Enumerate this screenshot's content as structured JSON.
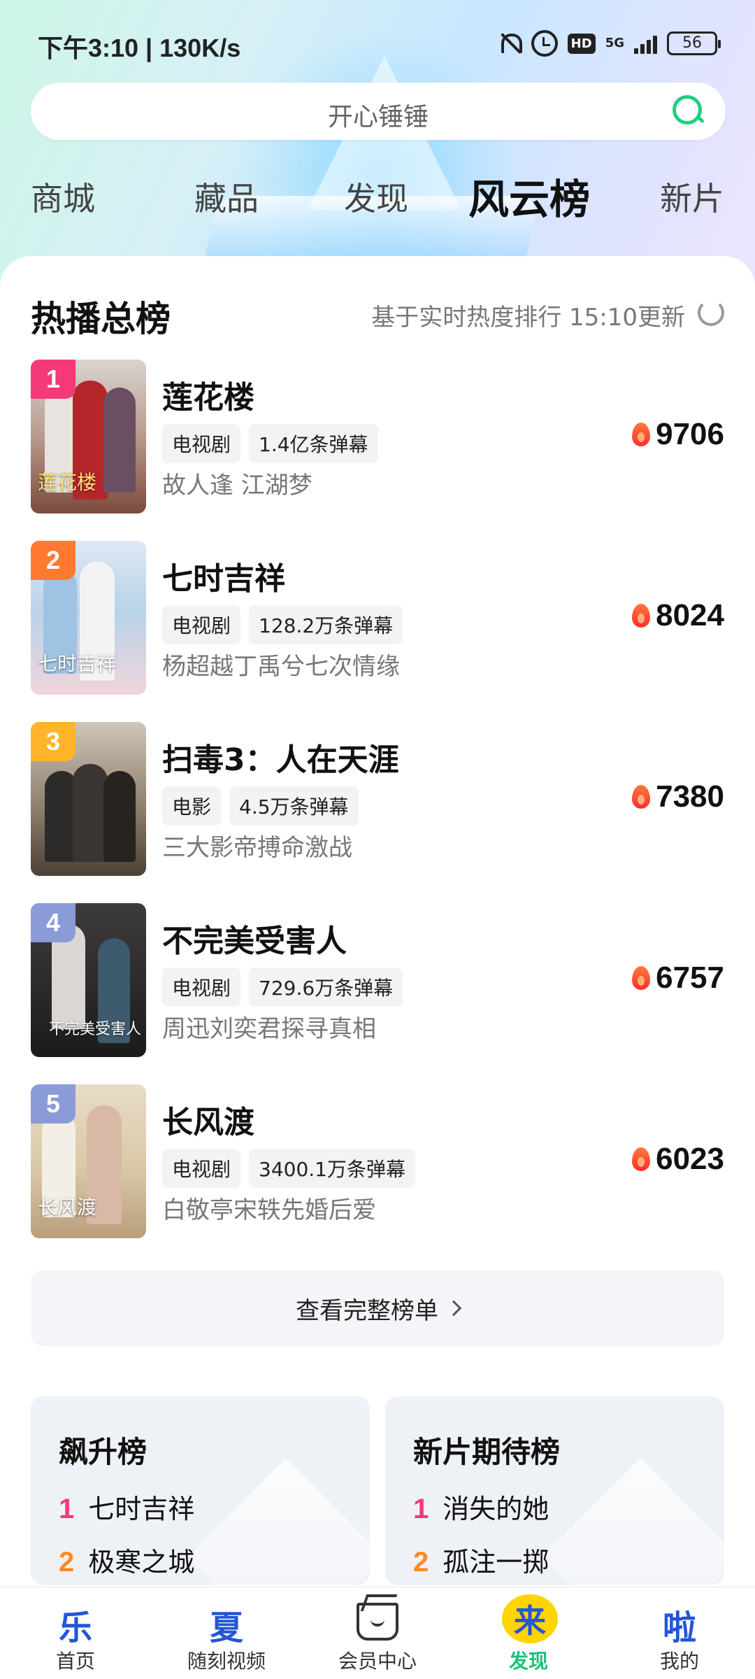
{
  "status_bar": {
    "time": "下午3:10 | 130K/s",
    "network": "5G",
    "hd": "HD",
    "battery": "56"
  },
  "search": {
    "placeholder": "开心锤锤"
  },
  "top_tabs": [
    {
      "label": "商城",
      "active": false
    },
    {
      "label": "藏品",
      "active": false
    },
    {
      "label": "发现",
      "active": false
    },
    {
      "label": "风云榜",
      "active": true
    },
    {
      "label": "新片",
      "active": false
    }
  ],
  "hot_board": {
    "title": "热播总榜",
    "meta": "基于实时热度排行 15:10更新",
    "items": [
      {
        "rank": "1",
        "title": "莲花楼",
        "type": "电视剧",
        "danmaku": "1.4亿条弹幕",
        "desc": "故人逢 江湖梦",
        "heat": "9706",
        "badge_color": "#f43a78"
      },
      {
        "rank": "2",
        "title": "七时吉祥",
        "type": "电视剧",
        "danmaku": "128.2万条弹幕",
        "desc": "杨超越丁禹兮七次情缘",
        "heat": "8024",
        "badge_color": "#ff7a30"
      },
      {
        "rank": "3",
        "title": "扫毒3：人在天涯",
        "type": "电影",
        "danmaku": "4.5万条弹幕",
        "desc": "三大影帝搏命激战",
        "heat": "7380",
        "badge_color": "#ffb429"
      },
      {
        "rank": "4",
        "title": "不完美受害人",
        "type": "电视剧",
        "danmaku": "729.6万条弹幕",
        "desc": "周迅刘奕君探寻真相",
        "heat": "6757",
        "badge_color": "#8a9bd8"
      },
      {
        "rank": "5",
        "title": "长风渡",
        "type": "电视剧",
        "danmaku": "3400.1万条弹幕",
        "desc": "白敬亭宋轶先婚后爱",
        "heat": "6023",
        "badge_color": "#8a9bd8"
      }
    ],
    "full_list_label": "查看完整榜单"
  },
  "rising_board": {
    "title": "飙升榜",
    "items": [
      {
        "rank": "1",
        "title": "七时吉祥"
      },
      {
        "rank": "2",
        "title": "极寒之城"
      }
    ]
  },
  "anticipated_board": {
    "title": "新片期待榜",
    "items": [
      {
        "rank": "1",
        "title": "消失的她"
      },
      {
        "rank": "2",
        "title": "孤注一掷"
      }
    ]
  },
  "bottom_nav": [
    {
      "glyph": "乐",
      "label": "首页"
    },
    {
      "glyph": "夏",
      "label": "随刻视频"
    },
    {
      "glyph": "",
      "label": "会员中心"
    },
    {
      "glyph": "来",
      "label": "发现",
      "active": true
    },
    {
      "glyph": "啦",
      "label": "我的"
    }
  ],
  "colors": {
    "accent_green": "#1fcf7e",
    "rank1": "#f43a78",
    "rank2": "#ff8a1f",
    "active_nav": "#19c27a"
  }
}
